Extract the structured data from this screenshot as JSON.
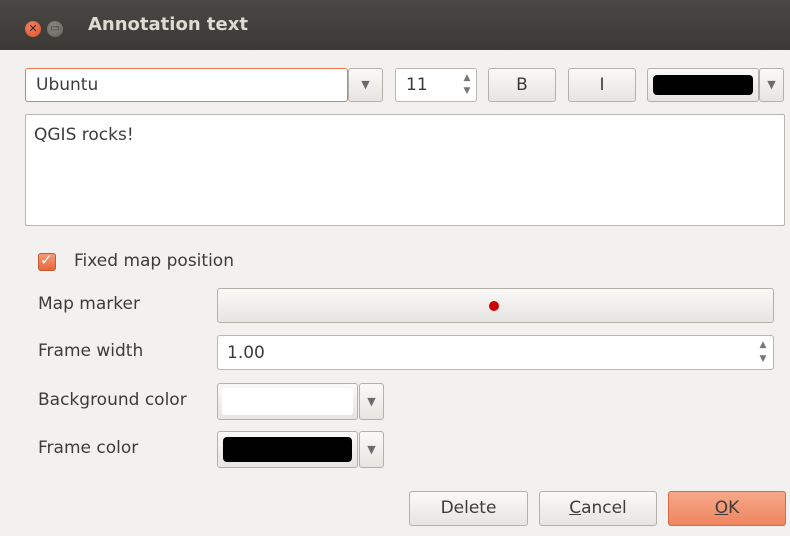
{
  "window": {
    "title": "Annotation text"
  },
  "font": {
    "family_value": "Ubuntu",
    "size_value": "11",
    "bold_label": "B",
    "italic_label": "I",
    "text_color": "#000000"
  },
  "editor": {
    "text": "QGIS rocks!"
  },
  "options": {
    "fixed_map_position_label": "Fixed map position",
    "fixed_map_position_checked": true,
    "map_marker_label": "Map marker",
    "marker_color": "#cc0000",
    "frame_width_label": "Frame width",
    "frame_width_value": "1.00",
    "background_color_label": "Background color",
    "background_color": "#ffffff",
    "frame_color_label": "Frame color",
    "frame_color": "#000000"
  },
  "buttons": {
    "delete": "Delete",
    "cancel_prefix": "C",
    "cancel_rest": "ancel",
    "ok_prefix": "O",
    "ok_rest": "K"
  },
  "colors": {
    "accent": "#f0784a",
    "ok_button": "#f49a78",
    "titlebar": "#3c3b37"
  }
}
